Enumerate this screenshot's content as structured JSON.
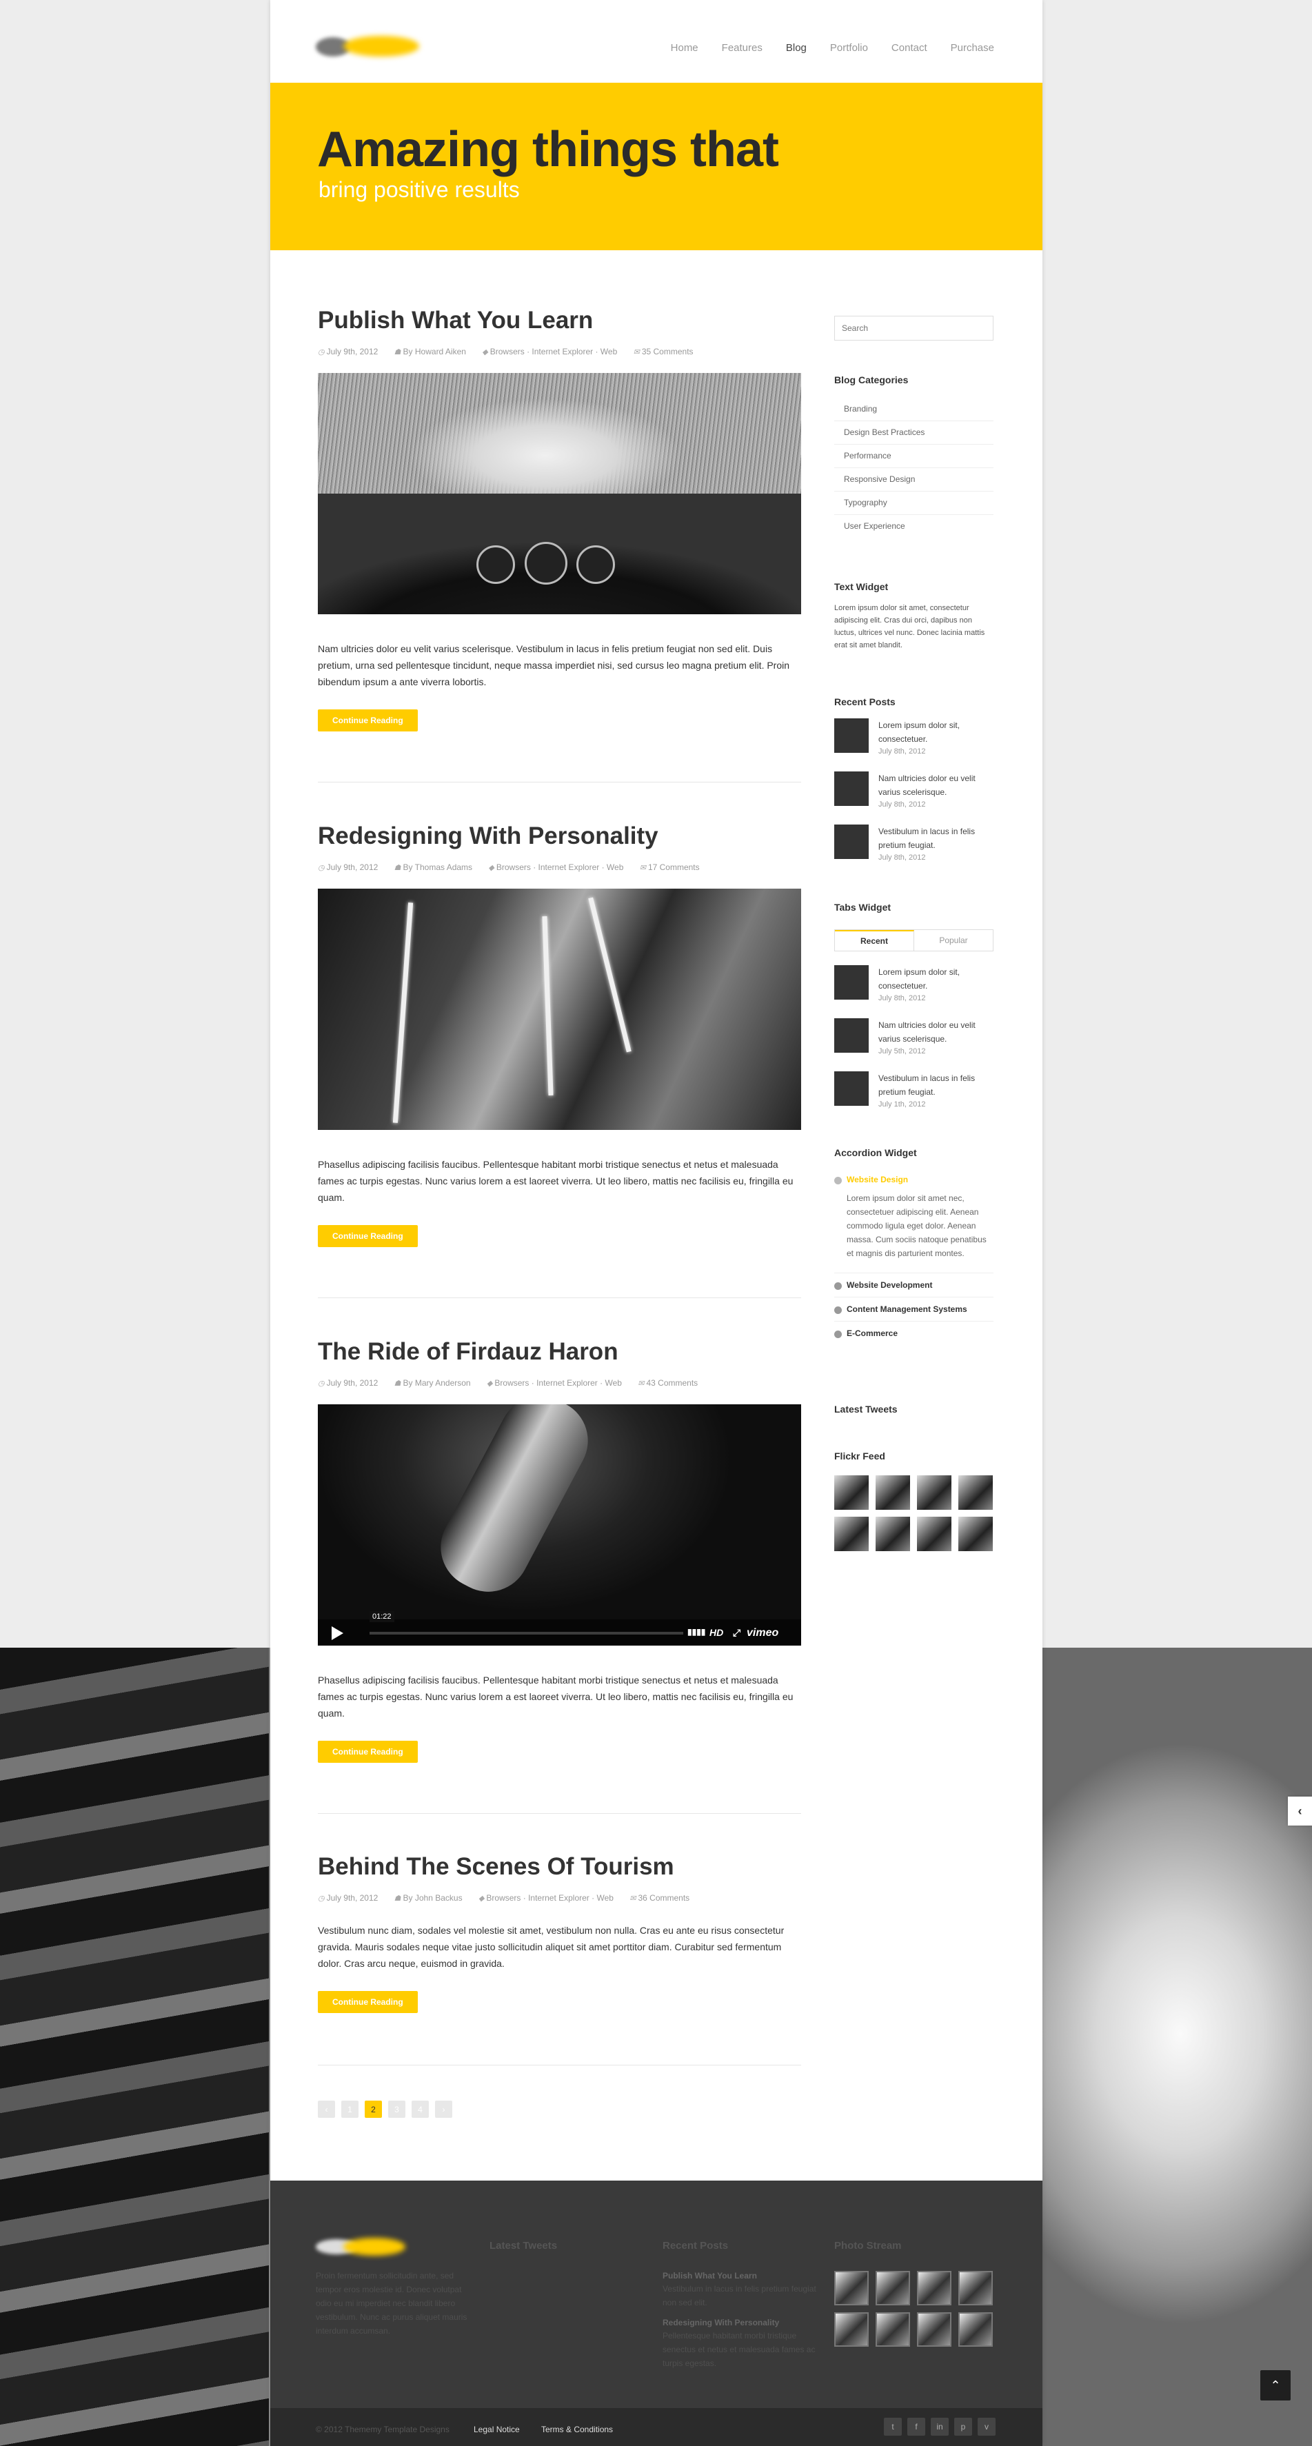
{
  "nav": {
    "items": [
      "Home",
      "Features",
      "Blog",
      "Portfolio",
      "Contact",
      "Purchase"
    ],
    "active": "Blog"
  },
  "hero": {
    "title": "Amazing things that",
    "subtitle": "bring positive results"
  },
  "posts": [
    {
      "title": "Publish What You Learn",
      "date": "July 9th, 2012",
      "author": "By Howard Aiken",
      "tags": "Browsers · Internet Explorer · Web",
      "comments": "35 Comments",
      "excerpt": "Nam ultricies dolor eu velit varius scelerisque. Vestibulum in lacus in felis pretium feugiat non sed elit. Duis pretium, urna sed pellentesque tincidunt, neque massa imperdiet nisi, sed cursus leo magna pretium elit. Proin bibendum ipsum a ante viverra lobortis.",
      "button": "Continue Reading"
    },
    {
      "title": "Redesigning With Personality",
      "date": "July 9th, 2012",
      "author": "By Thomas Adams",
      "tags": "Browsers · Internet Explorer · Web",
      "comments": "17 Comments",
      "excerpt": "Phasellus adipiscing facilisis faucibus. Pellentesque habitant morbi tristique senectus et netus et malesuada fames ac turpis egestas. Nunc varius lorem a est laoreet viverra. Ut leo libero, mattis nec facilisis eu, fringilla eu quam.",
      "button": "Continue Reading"
    },
    {
      "title": "The Ride of Firdauz Haron",
      "date": "July 9th, 2012",
      "author": "By Mary Anderson",
      "tags": "Browsers · Internet Explorer · Web",
      "comments": "43 Comments",
      "excerpt": "Phasellus adipiscing facilisis faucibus. Pellentesque habitant morbi tristique senectus et netus et malesuada fames ac turpis egestas. Nunc varius lorem a est laoreet viverra. Ut leo libero, mattis nec facilisis eu, fringilla eu quam.",
      "button": "Continue Reading",
      "video": {
        "time": "01:22",
        "hd": "HD",
        "brand": "vimeo"
      }
    },
    {
      "title": "Behind The Scenes Of Tourism",
      "date": "July 9th, 2012",
      "author": "By John Backus",
      "tags": "Browsers · Internet Explorer · Web",
      "comments": "36 Comments",
      "excerpt": "Vestibulum nunc diam, sodales vel molestie sit amet, vestibulum non nulla. Cras eu ante eu risus consectetur gravida. Mauris sodales neque vitae justo sollicitudin aliquet sit amet porttitor diam. Curabitur sed fermentum dolor. Cras arcu neque, euismod in gravida.",
      "button": "Continue Reading"
    }
  ],
  "pagination": {
    "prev": "‹",
    "pages": [
      "1",
      "2",
      "3",
      "4"
    ],
    "current": "2",
    "next": "›"
  },
  "sidebar": {
    "search_placeholder": "Search",
    "categories_title": "Blog Categories",
    "categories": [
      "Branding",
      "Design Best Practices",
      "Performance",
      "Responsive Design",
      "Typography",
      "User Experience"
    ],
    "text_widget_title": "Text Widget",
    "text_widget_body": "Lorem ipsum dolor sit amet, consectetur adipiscing elit. Cras dui orci, dapibus non luctus, ultrices vel nunc. Donec lacinia mattis erat sit amet blandit.",
    "recent_title": "Recent Posts",
    "recent": [
      {
        "title": "Lorem ipsum dolor sit, consectetuer.",
        "date": "July 8th, 2012"
      },
      {
        "title": "Nam ultricies dolor eu velit varius scelerisque.",
        "date": "July 8th, 2012"
      },
      {
        "title": "Vestibulum in lacus in felis pretium feugiat.",
        "date": "July 8th, 2012"
      }
    ],
    "tabs_title": "Tabs Widget",
    "tabs": [
      "Recent",
      "Popular"
    ],
    "tab_posts": [
      {
        "title": "Lorem ipsum dolor sit, consectetuer.",
        "date": "July 8th, 2012"
      },
      {
        "title": "Nam ultricies dolor eu velit varius scelerisque.",
        "date": "July 5th, 2012"
      },
      {
        "title": "Vestibulum in lacus in felis pretium feugiat.",
        "date": "July 1th, 2012"
      }
    ],
    "accordion_title": "Accordion Widget",
    "accordion": [
      "Website Design",
      "Website Development",
      "Content Management Systems",
      "E-Commerce"
    ],
    "accordion_body": "Lorem ipsum dolor sit amet nec, consectetuer adipiscing elit. Aenean commodo ligula eget dolor. Aenean massa. Cum sociis natoque penatibus et magnis dis parturient montes.",
    "tweets_title": "Latest Tweets",
    "flickr_title": "Flickr Feed"
  },
  "footer": {
    "about": "Proin fermentum sollicitudin ante, sed tempor eros molestie id. Donec volutpat odio eu mi imperdiet nec blandit libero vestibulum. Nunc ac purus aliquet mauris interdum accumsan.",
    "tweets_title": "Latest Tweets",
    "recent_title": "Recent Posts",
    "recent": [
      {
        "title": "Publish What You Learn",
        "text": "Vestibulum in lacus in felis pretium feugiat non sed elit."
      },
      {
        "title": "Redesigning With Personality",
        "text": "Pellentesque habitant morbi tristique senectus et netus et malesuada fames ac turpis egestas."
      }
    ],
    "photo_title": "Photo Stream",
    "copyright": "© 2012 Thememy Template Designs",
    "links": [
      "Legal Notice",
      "Terms & Conditions"
    ],
    "social": [
      "t",
      "f",
      "in",
      "p",
      "v"
    ]
  },
  "colors": {
    "accent": "#ffcc00",
    "dark": "#3a3a3a",
    "text": "#333333"
  }
}
